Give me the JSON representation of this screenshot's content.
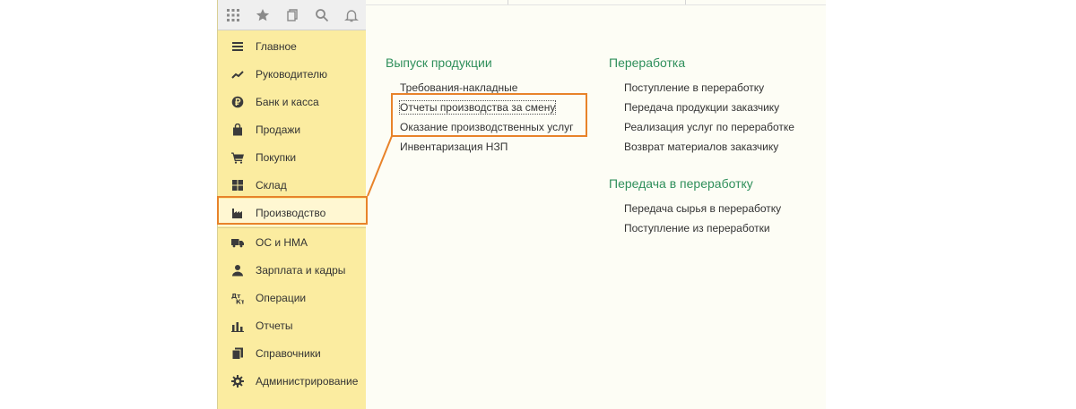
{
  "topbar": {
    "icons": [
      "apps-grid-icon",
      "star-icon",
      "history-icon",
      "search-icon",
      "bell-icon"
    ]
  },
  "sidebar": {
    "items": [
      {
        "label": "Главное",
        "icon": "menu-lines-icon"
      },
      {
        "label": "Руководителю",
        "icon": "trend-chart-icon"
      },
      {
        "label": "Банк и касса",
        "icon": "ruble-coin-icon"
      },
      {
        "label": "Продажи",
        "icon": "shopping-bag-icon"
      },
      {
        "label": "Покупки",
        "icon": "cart-icon"
      },
      {
        "label": "Склад",
        "icon": "warehouse-grid-icon"
      },
      {
        "label": "Производство",
        "icon": "factory-icon",
        "active": true
      },
      {
        "label": "ОС и НМА",
        "icon": "truck-icon"
      },
      {
        "label": "Зарплата и кадры",
        "icon": "person-icon"
      },
      {
        "label": "Операции",
        "icon": "operations-icon"
      },
      {
        "label": "Отчеты",
        "icon": "bar-chart-icon"
      },
      {
        "label": "Справочники",
        "icon": "book-icon"
      },
      {
        "label": "Администрирование",
        "icon": "gear-icon"
      }
    ]
  },
  "content": {
    "groups": {
      "vypusk": {
        "title": "Выпуск продукции",
        "links": [
          "Требования-накладные",
          "Отчеты производства за смену",
          "Оказание производственных услуг",
          "Инвентаризация НЗП"
        ]
      },
      "pererabotka": {
        "title": "Переработка",
        "links": [
          "Поступление в переработку",
          "Передача продукции заказчику",
          "Реализация услуг по переработке",
          "Возврат материалов заказчику"
        ]
      },
      "peredacha": {
        "title": "Передача в переработку",
        "links": [
          "Передача сырья в переработку",
          "Поступление из переработки"
        ]
      }
    }
  },
  "colors": {
    "sidebar_bg": "#fbeca0",
    "group_title": "#2f8f5b",
    "highlight": "#e8832a"
  }
}
